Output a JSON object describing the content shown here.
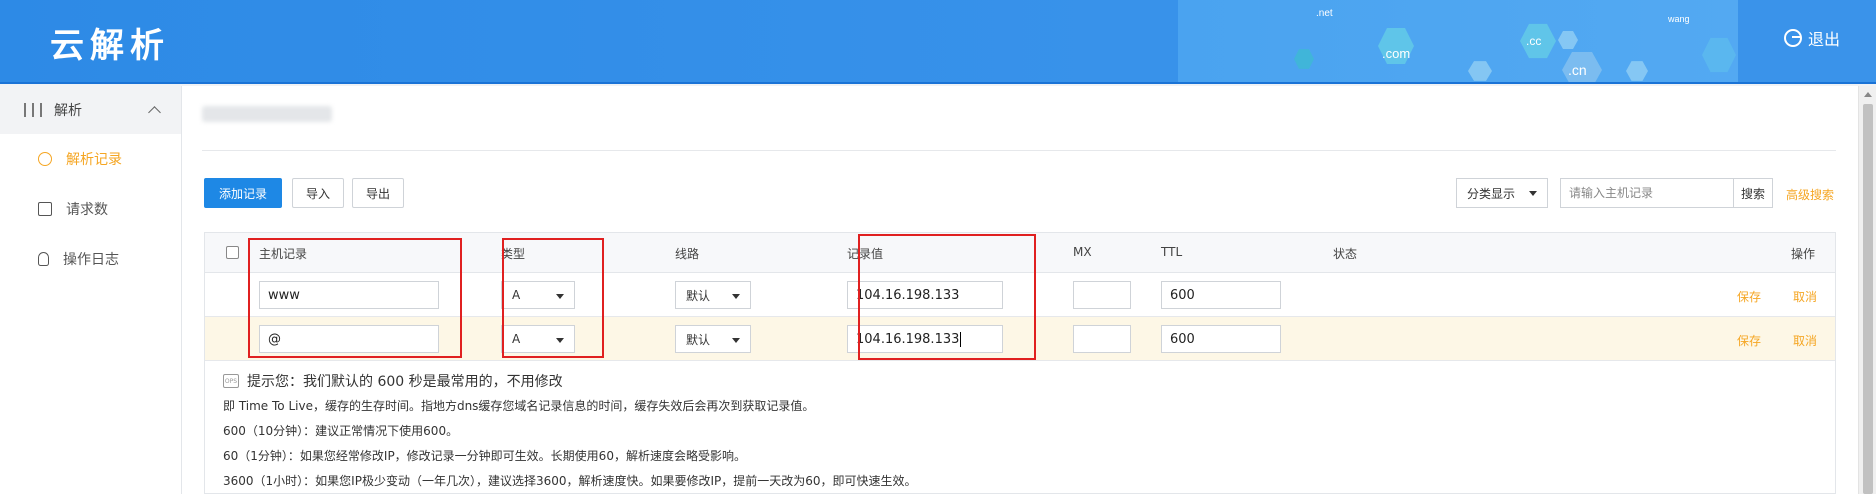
{
  "header": {
    "logo": "云解析",
    "logout_label": "退出",
    "tlds": [
      ".net",
      ".com",
      ".cc",
      ".cn",
      "wang"
    ]
  },
  "sidebar": {
    "group_label": "解析",
    "items": [
      {
        "label": "解析记录",
        "active": true
      },
      {
        "label": "请求数",
        "active": false
      },
      {
        "label": "操作日志",
        "active": false
      }
    ]
  },
  "toolbar": {
    "add_label": "添加记录",
    "import_label": "导入",
    "export_label": "导出",
    "category_label": "分类显示",
    "search_placeholder": "请输入主机记录",
    "search_button": "搜索",
    "advanced_search": "高级搜索"
  },
  "table": {
    "headers": {
      "host": "主机记录",
      "type": "类型",
      "line": "线路",
      "value": "记录值",
      "mx": "MX",
      "ttl": "TTL",
      "status": "状态",
      "action": "操作"
    },
    "rows": [
      {
        "host": "www",
        "type": "A",
        "line": "默认",
        "value": "104.16.198.133",
        "mx": "",
        "ttl": "600",
        "save": "保存",
        "cancel": "取消"
      },
      {
        "host": "@",
        "type": "A",
        "line": "默认",
        "value": "104.16.198.133",
        "mx": "",
        "ttl": "600",
        "save": "保存",
        "cancel": "取消"
      }
    ]
  },
  "tips": {
    "icon_text": "OPS",
    "title": "提示您：我们默认的 600 秒是最常用的，不用修改",
    "lines": [
      "即 Time To Live，缓存的生存时间。指地方dns缓存您域名记录信息的时间，缓存失效后会再次到获取记录值。",
      "600（10分钟）：建议正常情况下使用600。",
      "60（1分钟）：如果您经常修改IP，修改记录一分钟即可生效。长期使用60，解析速度会略受影响。",
      "3600（1小时）：如果您IP极少变动（一年几次），建议选择3600，解析速度快。如果要修改IP，提前一天改为60，即可快速生效。"
    ]
  },
  "colors": {
    "header_blue": "#2d8ae6",
    "accent_orange": "#f5a623",
    "primary_button": "#1e88e5",
    "highlight_box": "#e02020"
  }
}
